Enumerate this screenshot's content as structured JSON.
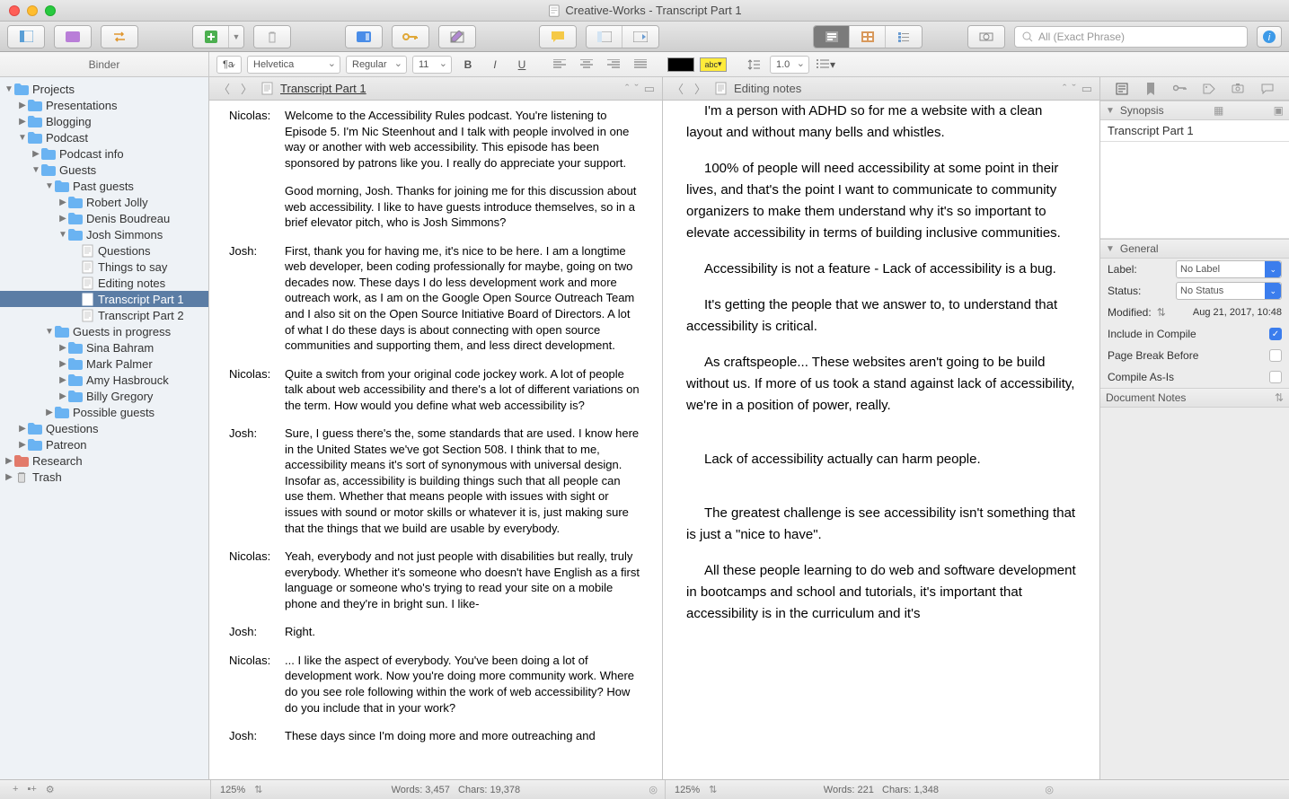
{
  "window": {
    "title": "Creative-Works - Transcript Part 1"
  },
  "search": {
    "placeholder": "All (Exact Phrase)"
  },
  "binder": {
    "header": "Binder",
    "top": [
      {
        "label": "Projects",
        "icon": "folder-blue"
      },
      {
        "label": "Research",
        "icon": "folder-red"
      },
      {
        "label": "Trash",
        "icon": "trash"
      }
    ],
    "projects_children": [
      {
        "label": "Presentations"
      },
      {
        "label": "Blogging"
      },
      {
        "label": "Podcast",
        "open": true
      },
      {
        "label": "Questions"
      },
      {
        "label": "Patreon"
      }
    ],
    "podcast_children": [
      {
        "label": "Podcast info"
      },
      {
        "label": "Guests",
        "open": true
      }
    ],
    "guests_children": [
      {
        "label": "Past guests",
        "open": true
      },
      {
        "label": "Guests in progress",
        "open": true
      },
      {
        "label": "Possible guests"
      }
    ],
    "past_guests": [
      {
        "label": "Robert Jolly"
      },
      {
        "label": "Denis Boudreau"
      },
      {
        "label": "Josh Simmons",
        "open": true
      }
    ],
    "josh_docs": [
      {
        "label": "Questions"
      },
      {
        "label": "Things to say"
      },
      {
        "label": "Editing notes"
      },
      {
        "label": "Transcript Part 1",
        "selected": true
      },
      {
        "label": "Transcript Part 2"
      }
    ],
    "in_progress": [
      {
        "label": "Sina Bahram"
      },
      {
        "label": "Mark Palmer"
      },
      {
        "label": "Amy Hasbrouck"
      },
      {
        "label": "Billy Gregory"
      }
    ]
  },
  "formatbar": {
    "font": "Helvetica",
    "weight": "Regular",
    "size": "11",
    "spacing": "1.0",
    "highlight_label": "abc"
  },
  "editor1": {
    "title": "Transcript Part 1",
    "rows": [
      {
        "sp": "Nicolas:",
        "txt": "Welcome to the Accessibility Rules podcast. You're listening to Episode 5. I'm Nic Steenhout and I talk with people involved in one way or another with web accessibility. This episode has been sponsored by patrons like you. I really do appreciate your support."
      },
      {
        "sp": "",
        "txt": "Good morning, Josh. Thanks for joining me for this discussion about web accessibility. I like to have guests introduce themselves, so in a brief elevator pitch, who is Josh Simmons?"
      },
      {
        "sp": "Josh:",
        "txt": "First, thank you for having me, it's nice to be here. I am a longtime web developer, been coding professionally for maybe, going on two decades now. These days I do less development work and more outreach work, as I am on the Google Open Source Outreach Team and I also sit on the Open Source Initiative Board of Directors. A lot of what I do these days is about connecting with open source communities and supporting them, and less direct development."
      },
      {
        "sp": "Nicolas:",
        "txt": "Quite a switch from your original code jockey work. A lot of people talk about web accessibility and there's a lot of different variations on the term. How would you define what web accessibility is?"
      },
      {
        "sp": "Josh:",
        "txt": "Sure, I guess there's the, some standards that are used. I know here in the United States we've got Section 508. I think that to me, accessibility means it's sort of synonymous with universal design. Insofar as, accessibility is building things such that all people can use them. Whether that means people with issues with sight or issues with sound or motor skills or whatever it is, just making sure that the things that we build are usable by everybody."
      },
      {
        "sp": "Nicolas:",
        "txt": "Yeah, everybody and not just people with disabilities but really, truly everybody. Whether it's someone who doesn't have English as a first language or someone who's trying to read your site on a mobile phone and they're in bright sun. I like-"
      },
      {
        "sp": "Josh:",
        "txt": "Right."
      },
      {
        "sp": "Nicolas:",
        "txt": "... I like the aspect of everybody. You've been doing a lot of development work. Now you're doing more community work. Where do you see role following within the work of web accessibility? How do you include that in your work?"
      },
      {
        "sp": "Josh:",
        "txt": "These days since I'm doing more and more outreaching and"
      }
    ],
    "footer": {
      "zoom": "125%",
      "words": "Words: 3,457",
      "chars": "Chars: 19,378"
    }
  },
  "editor2": {
    "title": "Editing notes",
    "paras": [
      "I'm a person with ADHD so for me a website with a clean layout and without many bells and whistles.",
      "100% of people will need accessibility at some point in their lives, and that's the point I want to communicate to community organizers to make them understand why it's so important to elevate accessibility in terms of building inclusive communities.",
      "Accessibility is not a feature - Lack of accessibility is a bug.",
      "It's getting the people that we answer to, to understand that accessibility is critical.",
      "As craftspeople... These websites aren't going to be build without us. If more of us took a stand against lack of accessibility, we're in a position of power, really.",
      "Lack of accessibility actually can harm people.",
      "The greatest challenge is see accessibility isn't something that is just a \"nice to have\".",
      "All these people learning to do web and software development in bootcamps and school and tutorials, it's important that accessibility is in the curriculum and it's"
    ],
    "footer": {
      "zoom": "125%",
      "words": "Words: 221",
      "chars": "Chars: 1,348"
    }
  },
  "inspector": {
    "synopsis_hd": "Synopsis",
    "synopsis_title": "Transcript Part 1",
    "general_hd": "General",
    "label_lbl": "Label:",
    "label_val": "No Label",
    "status_lbl": "Status:",
    "status_val": "No Status",
    "modified_lbl": "Modified:",
    "modified_val": "Aug 21, 2017, 10:48",
    "include_lbl": "Include in Compile",
    "pagebreak_lbl": "Page Break Before",
    "compileasis_lbl": "Compile As-Is",
    "docnotes_hd": "Document Notes"
  }
}
